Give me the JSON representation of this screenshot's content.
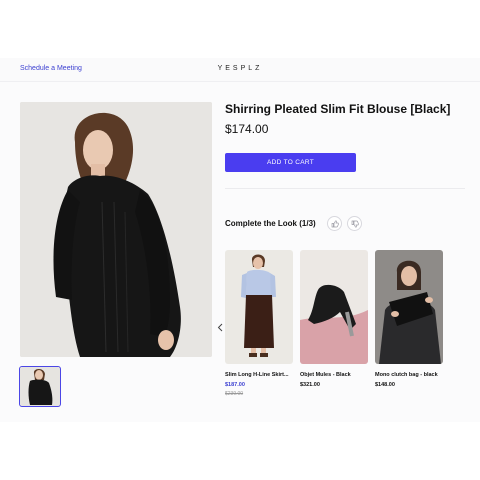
{
  "header": {
    "schedule_label": "Schedule a Meeting",
    "brand": "YESPLZ"
  },
  "product": {
    "title": "Shirring Pleated Slim Fit Blouse [Black]",
    "price": "$174.00",
    "add_to_cart_label": "ADD TO CART"
  },
  "complete_the_look": {
    "title": "Complete the Look (1/3)",
    "items": [
      {
        "name": "Slim Long H-Line Skirt...",
        "price": "$187.00",
        "original_price": "$239.00"
      },
      {
        "name": "Objet Mules - Black",
        "price": "$321.00"
      },
      {
        "name": "Mono clutch bag - black",
        "price": "$148.00"
      }
    ]
  },
  "colors": {
    "accent": "#4a3df0",
    "link": "#3b3fd1"
  },
  "icons": [
    "thumbs-up-icon",
    "thumbs-down-icon",
    "chevron-left-icon"
  ]
}
